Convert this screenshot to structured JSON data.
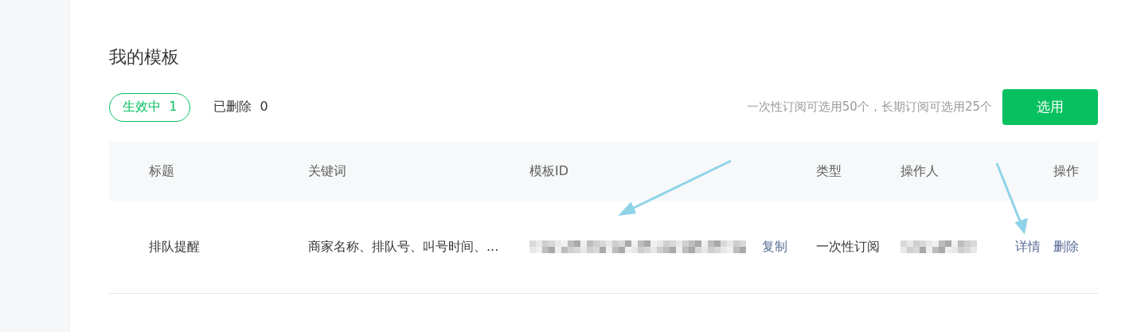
{
  "page_title": "我的模板",
  "tabs": [
    {
      "label": "生效中",
      "count": "1",
      "selected": true
    },
    {
      "label": "已删除",
      "count": "0",
      "selected": false
    }
  ],
  "quota_note": "一次性订阅可选用50个，长期订阅可选用25个",
  "select_button": "选用",
  "table": {
    "columns": [
      "标题",
      "关键词",
      "模板ID",
      "类型",
      "操作人",
      "操作"
    ],
    "rows": [
      {
        "title": "排队提醒",
        "keywords": "商家名称、排队号、叫号时间、...",
        "copy_link": "复制",
        "type": "一次性订阅",
        "actions": [
          "详情",
          "删除"
        ]
      }
    ]
  }
}
